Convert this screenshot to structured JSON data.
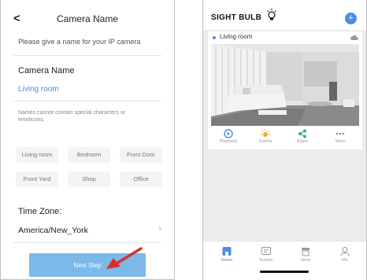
{
  "left": {
    "title": "Camera Name",
    "back_glyph": "<",
    "subtitle": "Please give a name for your IP camera",
    "camera_name_label": "Camera Name",
    "camera_name_value": "Living room",
    "hint": "Names cannot contain special characters or emoticons.",
    "suggestions": [
      "Living room",
      "Bedroom",
      "Front Door",
      "Front Yard",
      "Shop",
      "Office"
    ],
    "time_zone_label": "Time Zone:",
    "time_zone_value": "America/New_York",
    "chevron_glyph": "›",
    "next_button": "Next Step",
    "annotation_arrow_color": "#d9302b"
  },
  "right": {
    "brand": "SIGHT BULB",
    "brand_icon": "light-bulb-icon",
    "add_glyph": "+",
    "accent_color": "#4a8fe0",
    "camera_card": {
      "name": "Living room",
      "actions": [
        {
          "label": "Playback",
          "icon": "playback-icon",
          "color": "#4a8fe0"
        },
        {
          "label": "Events",
          "icon": "events-icon",
          "color": "#f2a93b"
        },
        {
          "label": "Share",
          "icon": "share-icon",
          "color": "#3bb36a"
        },
        {
          "label": "More",
          "icon": "more-icon",
          "color": "#888888"
        }
      ]
    },
    "tabs": [
      {
        "label": "Home",
        "icon": "home-icon",
        "active": true
      },
      {
        "label": "Events",
        "icon": "events-tab-icon",
        "active": false
      },
      {
        "label": "Store",
        "icon": "store-icon",
        "active": false
      },
      {
        "label": "Me",
        "icon": "profile-icon",
        "active": false
      }
    ]
  }
}
